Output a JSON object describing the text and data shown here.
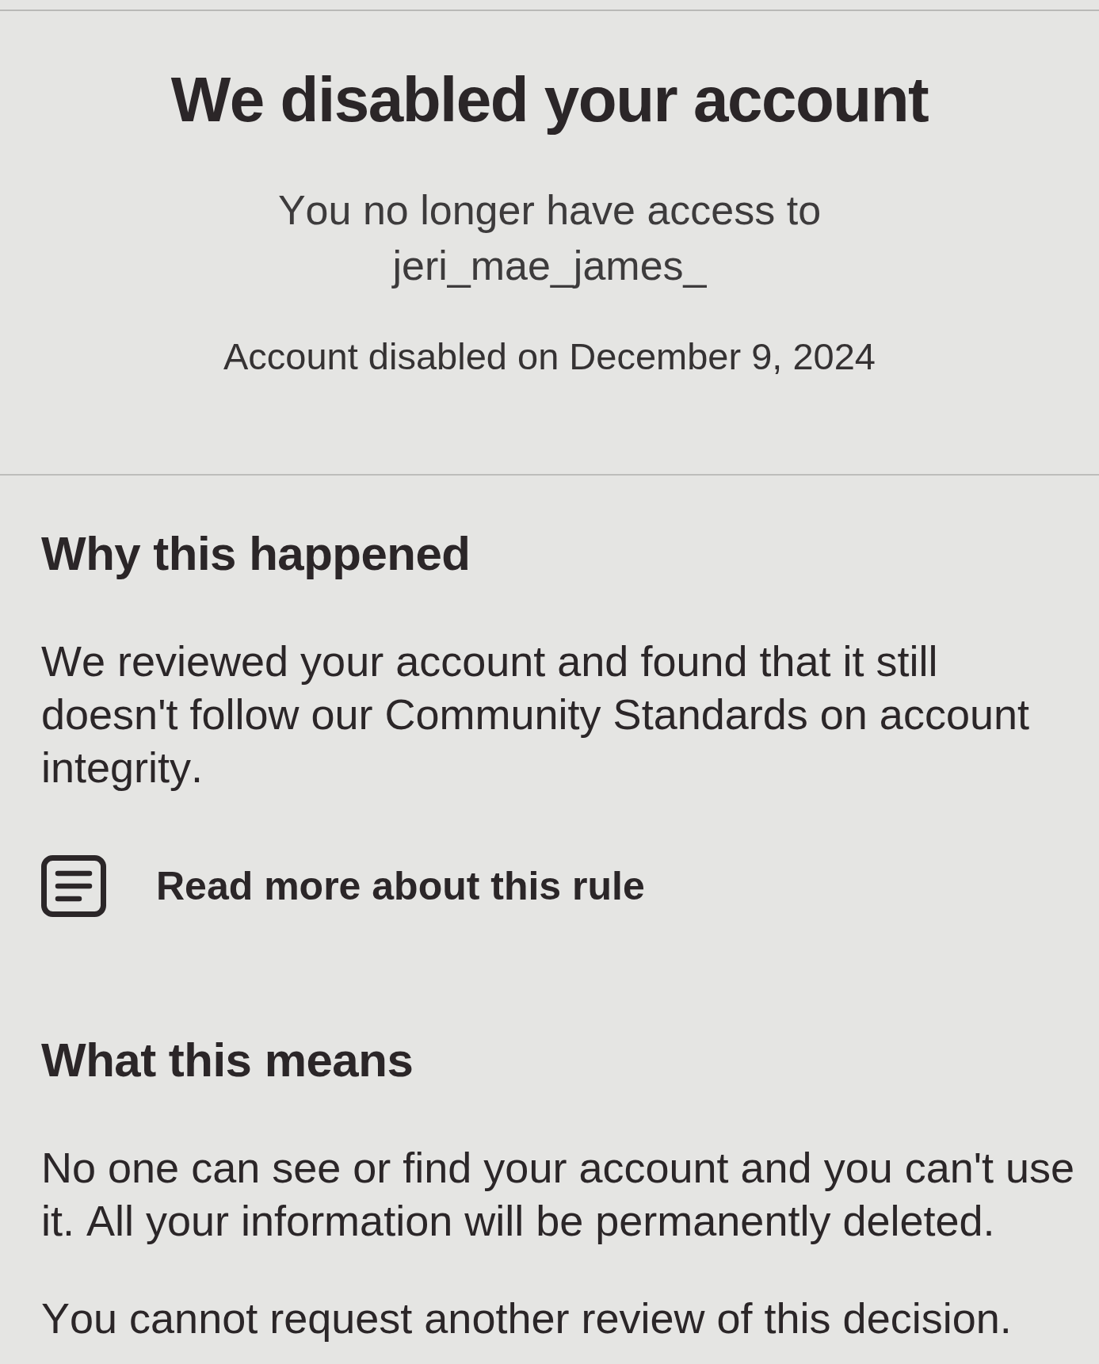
{
  "header": {
    "title": "We disabled your account",
    "access_message": "You no longer have access to",
    "username": "jeri_mae_james_",
    "disabled_date": "Account disabled on December 9, 2024"
  },
  "sections": [
    {
      "heading": "Why this happened",
      "paragraphs": [
        "We reviewed your account and found that it still doesn't follow our Community Standards on account integrity."
      ],
      "link": {
        "label": "Read more about this rule"
      }
    },
    {
      "heading": "What this means",
      "paragraphs": [
        "No one can see or find your account and you can't use it. All your information will be permanently deleted.",
        "You cannot request another review of this decision."
      ]
    }
  ]
}
